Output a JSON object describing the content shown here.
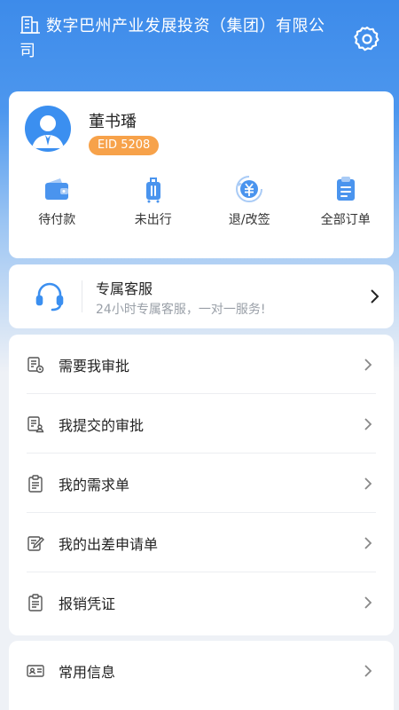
{
  "header": {
    "company_line1": "数字巴州产业发展投资（集团）有限公",
    "company_line2": "司"
  },
  "profile": {
    "name": "董书璠",
    "eid": "EID 5208"
  },
  "orders": [
    {
      "label": "待付款",
      "icon": "wallet-icon"
    },
    {
      "label": "未出行",
      "icon": "luggage-icon"
    },
    {
      "label": "退/改签",
      "icon": "refund-icon"
    },
    {
      "label": "全部订单",
      "icon": "clipboard-icon"
    }
  ],
  "service": {
    "title": "专属客服",
    "subtitle": "24小时专属客服，一对一服务!"
  },
  "menu": [
    {
      "label": "需要我审批",
      "icon": "approval-pending-icon"
    },
    {
      "label": "我提交的审批",
      "icon": "approval-submitted-icon"
    },
    {
      "label": "我的需求单",
      "icon": "requirement-icon"
    },
    {
      "label": "我的出差申请单",
      "icon": "trip-application-icon"
    },
    {
      "label": "报销凭证",
      "icon": "receipt-icon"
    }
  ],
  "info": {
    "label": "常用信息",
    "icon": "id-card-icon"
  },
  "colors": {
    "primary": "#3d8bea",
    "badge": "#f7a24a",
    "card": "#ffffff",
    "background": "#eef1f6"
  }
}
